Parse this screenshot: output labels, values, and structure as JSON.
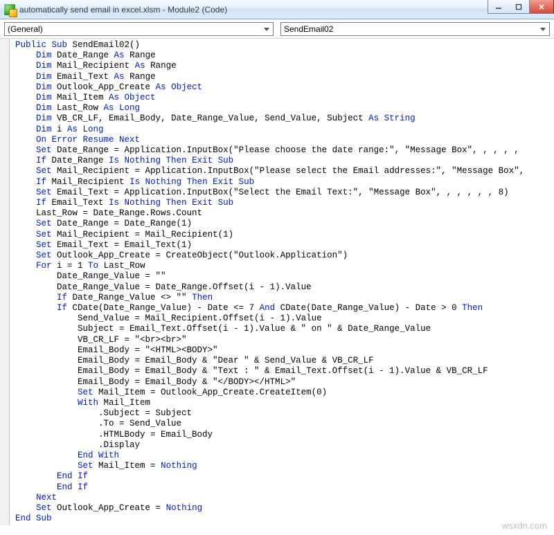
{
  "window": {
    "title": "automatically send email in excel.xlsm - Module2 (Code)"
  },
  "dropdowns": {
    "left": "(General)",
    "right": "SendEmail02"
  },
  "code": {
    "lines": [
      [
        {
          "t": "kw",
          "v": "Public Sub"
        },
        {
          "t": "",
          "v": " SendEmail02()"
        }
      ],
      [
        {
          "t": "in",
          "v": 1
        },
        {
          "t": "kw",
          "v": "Dim"
        },
        {
          "t": "",
          "v": " Date_Range "
        },
        {
          "t": "kw",
          "v": "As"
        },
        {
          "t": "",
          "v": " Range"
        }
      ],
      [
        {
          "t": "in",
          "v": 1
        },
        {
          "t": "kw",
          "v": "Dim"
        },
        {
          "t": "",
          "v": " Mail_Recipient "
        },
        {
          "t": "kw",
          "v": "As"
        },
        {
          "t": "",
          "v": " Range"
        }
      ],
      [
        {
          "t": "in",
          "v": 1
        },
        {
          "t": "kw",
          "v": "Dim"
        },
        {
          "t": "",
          "v": " Email_Text "
        },
        {
          "t": "kw",
          "v": "As"
        },
        {
          "t": "",
          "v": " Range"
        }
      ],
      [
        {
          "t": "in",
          "v": 1
        },
        {
          "t": "kw",
          "v": "Dim"
        },
        {
          "t": "",
          "v": " Outlook_App_Create "
        },
        {
          "t": "kw",
          "v": "As Object"
        }
      ],
      [
        {
          "t": "in",
          "v": 1
        },
        {
          "t": "kw",
          "v": "Dim"
        },
        {
          "t": "",
          "v": " Mail_Item "
        },
        {
          "t": "kw",
          "v": "As Object"
        }
      ],
      [
        {
          "t": "in",
          "v": 1
        },
        {
          "t": "kw",
          "v": "Dim"
        },
        {
          "t": "",
          "v": " Last_Row "
        },
        {
          "t": "kw",
          "v": "As Long"
        }
      ],
      [
        {
          "t": "in",
          "v": 1
        },
        {
          "t": "kw",
          "v": "Dim"
        },
        {
          "t": "",
          "v": " VB_CR_LF, Email_Body, Date_Range_Value, Send_Value, Subject "
        },
        {
          "t": "kw",
          "v": "As String"
        }
      ],
      [
        {
          "t": "in",
          "v": 1
        },
        {
          "t": "kw",
          "v": "Dim"
        },
        {
          "t": "",
          "v": " i "
        },
        {
          "t": "kw",
          "v": "As Long"
        }
      ],
      [
        {
          "t": "in",
          "v": 1
        },
        {
          "t": "kw",
          "v": "On Error Resume Next"
        }
      ],
      [
        {
          "t": "in",
          "v": 1
        },
        {
          "t": "kw",
          "v": "Set"
        },
        {
          "t": "",
          "v": " Date_Range = Application.InputBox(\"Please choose the date range:\", \"Message Box\", , , , ,"
        }
      ],
      [
        {
          "t": "in",
          "v": 1
        },
        {
          "t": "kw",
          "v": "If"
        },
        {
          "t": "",
          "v": " Date_Range "
        },
        {
          "t": "kw",
          "v": "Is Nothing Then Exit Sub"
        }
      ],
      [
        {
          "t": "in",
          "v": 1
        },
        {
          "t": "kw",
          "v": "Set"
        },
        {
          "t": "",
          "v": " Mail_Recipient = Application.InputBox(\"Please select the Email addresses:\", \"Message Box\","
        }
      ],
      [
        {
          "t": "in",
          "v": 1
        },
        {
          "t": "kw",
          "v": "If"
        },
        {
          "t": "",
          "v": " Mail_Recipient "
        },
        {
          "t": "kw",
          "v": "Is Nothing Then Exit Sub"
        }
      ],
      [
        {
          "t": "in",
          "v": 1
        },
        {
          "t": "kw",
          "v": "Set"
        },
        {
          "t": "",
          "v": " Email_Text = Application.InputBox(\"Select the Email Text:\", \"Message Box\", , , , , , 8)"
        }
      ],
      [
        {
          "t": "in",
          "v": 1
        },
        {
          "t": "kw",
          "v": "If"
        },
        {
          "t": "",
          "v": " Email_Text "
        },
        {
          "t": "kw",
          "v": "Is Nothing Then Exit Sub"
        }
      ],
      [
        {
          "t": "in",
          "v": 1
        },
        {
          "t": "",
          "v": "Last_Row = Date_Range.Rows.Count"
        }
      ],
      [
        {
          "t": "in",
          "v": 1
        },
        {
          "t": "kw",
          "v": "Set"
        },
        {
          "t": "",
          "v": " Date_Range = Date_Range(1)"
        }
      ],
      [
        {
          "t": "in",
          "v": 1
        },
        {
          "t": "kw",
          "v": "Set"
        },
        {
          "t": "",
          "v": " Mail_Recipient = Mail_Recipient(1)"
        }
      ],
      [
        {
          "t": "in",
          "v": 1
        },
        {
          "t": "kw",
          "v": "Set"
        },
        {
          "t": "",
          "v": " Email_Text = Email_Text(1)"
        }
      ],
      [
        {
          "t": "in",
          "v": 1
        },
        {
          "t": "kw",
          "v": "Set"
        },
        {
          "t": "",
          "v": " Outlook_App_Create = CreateObject(\"Outlook.Application\")"
        }
      ],
      [
        {
          "t": "in",
          "v": 1
        },
        {
          "t": "kw",
          "v": "For"
        },
        {
          "t": "",
          "v": " i = 1 "
        },
        {
          "t": "kw",
          "v": "To"
        },
        {
          "t": "",
          "v": " Last_Row"
        }
      ],
      [
        {
          "t": "in",
          "v": 2
        },
        {
          "t": "",
          "v": "Date_Range_Value = \"\""
        }
      ],
      [
        {
          "t": "in",
          "v": 2
        },
        {
          "t": "",
          "v": "Date_Range_Value = Date_Range.Offset(i - 1).Value"
        }
      ],
      [
        {
          "t": "in",
          "v": 2
        },
        {
          "t": "kw",
          "v": "If"
        },
        {
          "t": "",
          "v": " Date_Range_Value <> \"\" "
        },
        {
          "t": "kw",
          "v": "Then"
        }
      ],
      [
        {
          "t": "in",
          "v": 2
        },
        {
          "t": "kw",
          "v": "If"
        },
        {
          "t": "",
          "v": " CDate(Date_Range_Value) - Date <= 7 "
        },
        {
          "t": "kw",
          "v": "And"
        },
        {
          "t": "",
          "v": " CDate(Date_Range_Value) - Date > 0 "
        },
        {
          "t": "kw",
          "v": "Then"
        }
      ],
      [
        {
          "t": "in",
          "v": 3
        },
        {
          "t": "",
          "v": "Send_Value = Mail_Recipient.Offset(i - 1).Value"
        }
      ],
      [
        {
          "t": "in",
          "v": 3
        },
        {
          "t": "",
          "v": "Subject = Email_Text.Offset(i - 1).Value & \" on \" & Date_Range_Value"
        }
      ],
      [
        {
          "t": "in",
          "v": 3
        },
        {
          "t": "",
          "v": "VB_CR_LF = \"<br><br>\""
        }
      ],
      [
        {
          "t": "in",
          "v": 3
        },
        {
          "t": "",
          "v": "Email_Body = \"<HTML><BODY>\""
        }
      ],
      [
        {
          "t": "in",
          "v": 3
        },
        {
          "t": "",
          "v": "Email_Body = Email_Body & \"Dear \" & Send_Value & VB_CR_LF"
        }
      ],
      [
        {
          "t": "in",
          "v": 3
        },
        {
          "t": "",
          "v": "Email_Body = Email_Body & \"Text : \" & Email_Text.Offset(i - 1).Value & VB_CR_LF"
        }
      ],
      [
        {
          "t": "in",
          "v": 3
        },
        {
          "t": "",
          "v": "Email_Body = Email_Body & \"</BODY></HTML>\""
        }
      ],
      [
        {
          "t": "in",
          "v": 3
        },
        {
          "t": "kw",
          "v": "Set"
        },
        {
          "t": "",
          "v": " Mail_Item = Outlook_App_Create.CreateItem(0)"
        }
      ],
      [
        {
          "t": "in",
          "v": 3
        },
        {
          "t": "kw",
          "v": "With"
        },
        {
          "t": "",
          "v": " Mail_Item"
        }
      ],
      [
        {
          "t": "in",
          "v": 4
        },
        {
          "t": "",
          "v": ".Subject = Subject"
        }
      ],
      [
        {
          "t": "in",
          "v": 4
        },
        {
          "t": "",
          "v": ".To = Send_Value"
        }
      ],
      [
        {
          "t": "in",
          "v": 4
        },
        {
          "t": "",
          "v": ".HTMLBody = Email_Body"
        }
      ],
      [
        {
          "t": "in",
          "v": 4
        },
        {
          "t": "",
          "v": ".Display"
        }
      ],
      [
        {
          "t": "in",
          "v": 3
        },
        {
          "t": "kw",
          "v": "End With"
        }
      ],
      [
        {
          "t": "in",
          "v": 3
        },
        {
          "t": "kw",
          "v": "Set"
        },
        {
          "t": "",
          "v": " Mail_Item = "
        },
        {
          "t": "kw",
          "v": "Nothing"
        }
      ],
      [
        {
          "t": "in",
          "v": 2
        },
        {
          "t": "kw",
          "v": "End If"
        }
      ],
      [
        {
          "t": "in",
          "v": 2
        },
        {
          "t": "kw",
          "v": "End If"
        }
      ],
      [
        {
          "t": "in",
          "v": 1
        },
        {
          "t": "kw",
          "v": "Next"
        }
      ],
      [
        {
          "t": "in",
          "v": 1
        },
        {
          "t": "kw",
          "v": "Set"
        },
        {
          "t": "",
          "v": " Outlook_App_Create = "
        },
        {
          "t": "kw",
          "v": "Nothing"
        }
      ],
      [
        {
          "t": "kw",
          "v": "End Sub"
        }
      ]
    ]
  },
  "watermark": "wsxdn.com"
}
